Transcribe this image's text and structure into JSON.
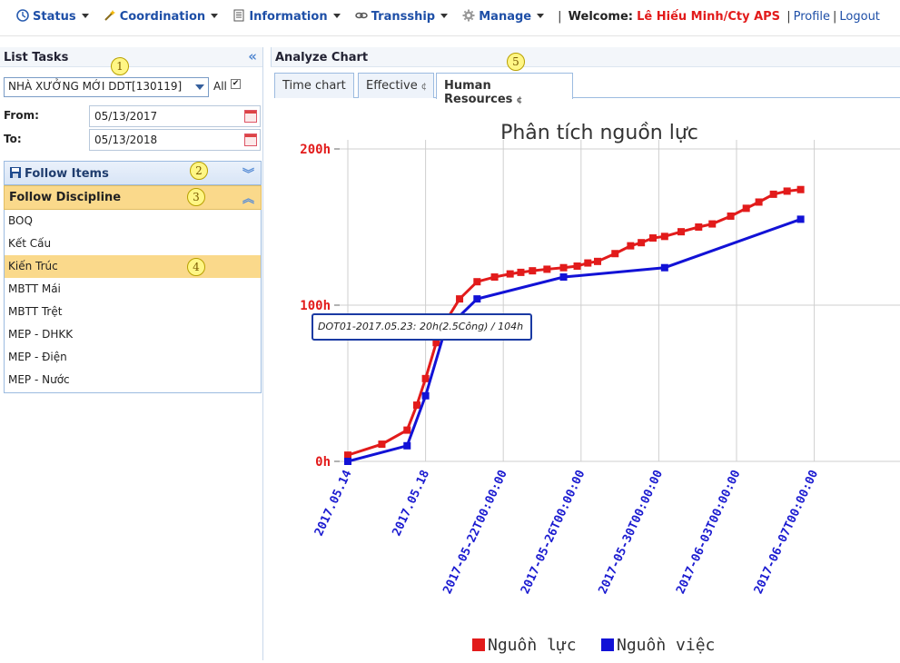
{
  "nav": {
    "items": [
      {
        "label": "Status",
        "icon": "clock-icon"
      },
      {
        "label": "Coordination",
        "icon": "wand-icon"
      },
      {
        "label": "Information",
        "icon": "document-icon"
      },
      {
        "label": "Transship",
        "icon": "link-icon"
      },
      {
        "label": "Manage",
        "icon": "gear-icon"
      }
    ],
    "separator": "|",
    "welcome_label": "Welcome:",
    "user_name": "Lê Hiếu Minh/Cty APS",
    "profile_label": "Profile",
    "logout_label": "Logout"
  },
  "left": {
    "title": "List Tasks",
    "collapse_icon": "«",
    "project_value": "NHÀ XƯỞNG MỚI DDT[130119]",
    "all_label": "All",
    "all_checked": true,
    "from_label": "From:",
    "from_value": "05/13/2017",
    "to_label": "To:",
    "to_value": "05/13/2018",
    "follow_items_label": "Follow Items",
    "follow_discipline_label": "Follow Discipline",
    "disciplines": [
      "BOQ",
      "Kết Cấu",
      "Kiến Trúc",
      "MBTT Mái",
      "MBTT Trệt",
      "MEP - DHKK",
      "MEP - Điện",
      "MEP - Nước"
    ],
    "selected_discipline_index": 2
  },
  "right": {
    "title": "Analyze Chart",
    "tabs": [
      {
        "label": "Time chart",
        "ref": ""
      },
      {
        "label": "Effective",
        "ref": "¢"
      },
      {
        "label": "Human Resources",
        "ref": "¢"
      }
    ],
    "active_tab": 2
  },
  "badges": [
    "1",
    "2",
    "3",
    "4",
    "5"
  ],
  "colors": {
    "accent": "#1e4fa7",
    "selected": "#fad98b",
    "series_red": "#e21b1b",
    "series_blue": "#1212d6"
  },
  "chart_data": {
    "type": "line",
    "title": "Phân tích nguồn lực",
    "y_ticks": [
      "0h",
      "100h",
      "200h"
    ],
    "ylim": [
      0,
      200
    ],
    "x_tick_labels": [
      "2017.05.14",
      "2017.05.18",
      "2017-05-22T00:00:00",
      "2017-05-26T00:00:00",
      "2017-05-30T00:00:00",
      "2017-06-03T00:00:00",
      "2017-06-07T00:00:00"
    ],
    "x_ticks_days": [
      0,
      4,
      8,
      12,
      16,
      20,
      24
    ],
    "grid": true,
    "legend_position": "bottom",
    "series": [
      {
        "name": "Nguồn lực",
        "color": "#e21b1b",
        "x": [
          0,
          1.75,
          3.05,
          3.55,
          4,
          4.55,
          5,
          5.75,
          6.65,
          7.55,
          8.35,
          8.9,
          9.5,
          10.25,
          11.1,
          11.8,
          12.35,
          12.85,
          13.75,
          14.55,
          15.1,
          15.7,
          16.3,
          17.15,
          18.05,
          18.75,
          19.7,
          20.5,
          21.15,
          21.9,
          22.6,
          23.3
        ],
        "y": [
          4,
          11,
          20,
          36,
          53,
          76,
          89,
          104,
          115,
          118,
          120,
          121,
          122,
          123,
          124,
          125,
          127,
          128,
          133,
          138,
          140,
          143,
          144,
          147,
          150,
          152,
          157,
          162,
          166,
          171,
          173,
          174
        ]
      },
      {
        "name": "Nguồn việc",
        "color": "#1212d6",
        "x": [
          0,
          3.05,
          4,
          5,
          6.65,
          11.1,
          16.3,
          23.3
        ],
        "y": [
          0,
          10,
          42,
          84,
          104,
          118,
          124,
          155
        ]
      }
    ],
    "tooltip": "DOT01-2017.05.23: 20h(2.5Công) / 104h"
  }
}
